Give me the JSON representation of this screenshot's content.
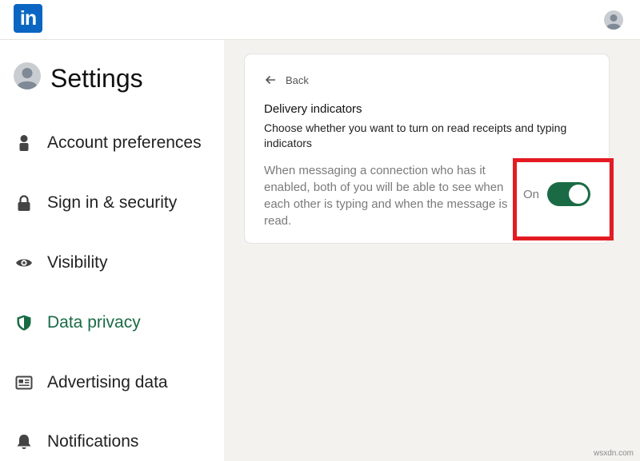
{
  "header": {
    "logo_text": "in"
  },
  "sidebar": {
    "title": "Settings",
    "items": [
      {
        "label": "Account preferences",
        "icon": "person-icon",
        "active": false
      },
      {
        "label": "Sign in & security",
        "icon": "lock-icon",
        "active": false
      },
      {
        "label": "Visibility",
        "icon": "eye-icon",
        "active": false
      },
      {
        "label": "Data privacy",
        "icon": "shield-icon",
        "active": true
      },
      {
        "label": "Advertising data",
        "icon": "newspaper-icon",
        "active": false
      },
      {
        "label": "Notifications",
        "icon": "bell-icon",
        "active": false
      }
    ]
  },
  "card": {
    "back_label": "Back",
    "title": "Delivery indicators",
    "subtitle": "Choose whether you want to turn on read receipts and typing indicators",
    "description": "When messaging a connection who has it enabled, both of you will be able to see when each other is typing and when the message is read.",
    "toggle_label": "On",
    "toggle_state": "on"
  },
  "watermark": "wsxdn.com",
  "colors": {
    "brand": "#0a66c2",
    "active_green": "#1a6b45",
    "highlight_red": "#e31b23",
    "background": "#f4f2ee"
  }
}
